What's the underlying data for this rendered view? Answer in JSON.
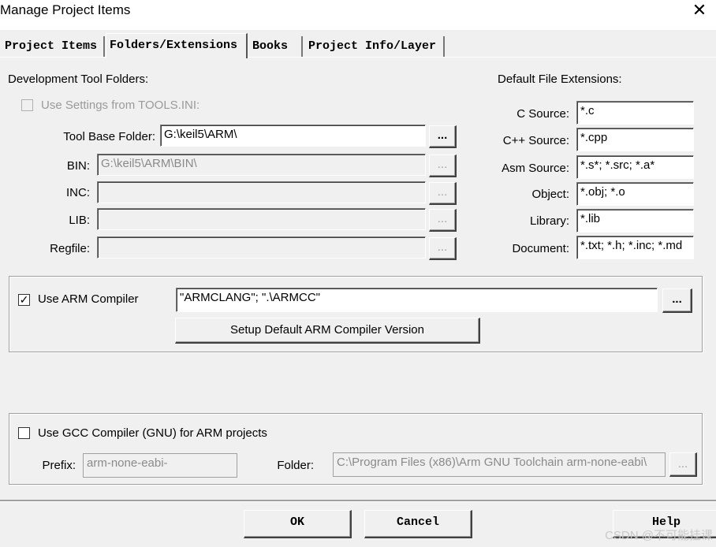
{
  "window": {
    "title": "Manage Project Items",
    "close_symbol": "✕"
  },
  "tabs": [
    {
      "label": "Project Items"
    },
    {
      "label": "Folders/Extensions"
    },
    {
      "label": "Books"
    },
    {
      "label": "Project Info/Layer"
    }
  ],
  "dev_folders": {
    "heading": "Development Tool Folders:",
    "use_tools_ini_label": "Use Settings from TOOLS.INI:",
    "tool_base_label": "Tool Base Folder:",
    "tool_base_value": "G:\\keil5\\ARM\\",
    "bin_label": "BIN:",
    "bin_value": "G:\\keil5\\ARM\\BIN\\",
    "inc_label": "INC:",
    "inc_value": "",
    "lib_label": "LIB:",
    "lib_value": "",
    "regfile_label": "Regfile:",
    "regfile_value": "",
    "browse_label": "..."
  },
  "extensions": {
    "heading": "Default File Extensions:",
    "c_label": "C Source:",
    "c_value": "*.c",
    "cpp_label": "C++ Source:",
    "cpp_value": "*.cpp",
    "asm_label": "Asm Source:",
    "asm_value": "*.s*; *.src; *.a*",
    "obj_label": "Object:",
    "obj_value": "*.obj; *.o",
    "lib_label": "Library:",
    "lib_value": "*.lib",
    "doc_label": "Document:",
    "doc_value": "*.txt; *.h; *.inc; *.md"
  },
  "arm": {
    "checked_mark": "✓",
    "label": "Use ARM Compiler",
    "value": "\"ARMCLANG\"; \".\\ARMCC\"",
    "browse_label": "...",
    "setup_label": "Setup Default ARM Compiler Version"
  },
  "gcc": {
    "label": "Use GCC Compiler (GNU) for ARM projects",
    "prefix_label": "Prefix:",
    "prefix_value": "arm-none-eabi-",
    "folder_label": "Folder:",
    "folder_value": "C:\\Program Files (x86)\\Arm GNU Toolchain arm-none-eabi\\",
    "browse_label": "..."
  },
  "buttons": {
    "ok": "OK",
    "cancel": "Cancel",
    "help": "Help"
  },
  "watermark": "CSDN @不可能挂课"
}
